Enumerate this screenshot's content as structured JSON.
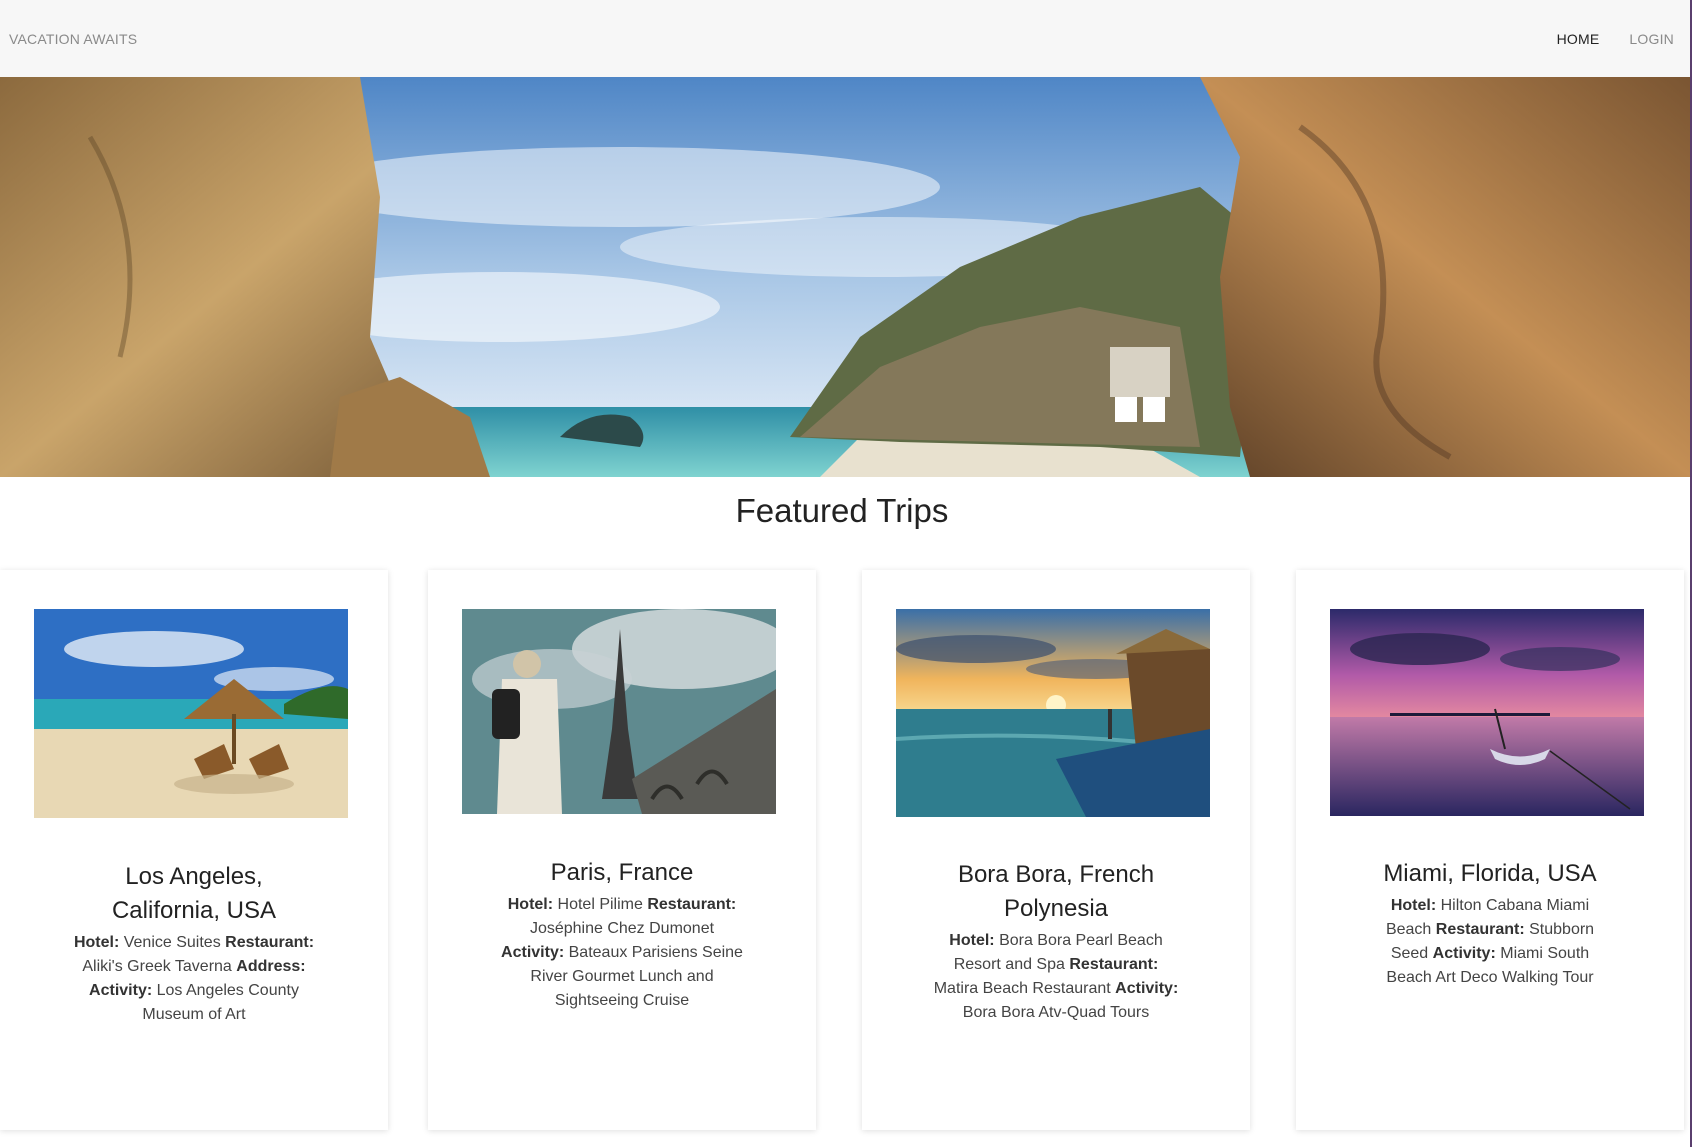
{
  "nav": {
    "brand": "VACATION AWAITS",
    "links": [
      {
        "label": "HOME",
        "active": true
      },
      {
        "label": "LOGIN",
        "active": false
      }
    ]
  },
  "hero": {
    "image": "coastal-cave-beach-photo"
  },
  "section": {
    "title": "Featured Trips"
  },
  "labels": {
    "hotel": "Hotel:",
    "restaurant": "Restaurant:",
    "address": "Address:",
    "activity": "Activity:"
  },
  "trips": [
    {
      "title": "Los Angeles, California, USA",
      "hotel": "Venice Suites",
      "restaurant": "Aliki's Greek Taverna",
      "address": "",
      "activity": "Los Angeles County Museum of Art",
      "image": "beach-umbrella-chairs-photo"
    },
    {
      "title": "Paris, France",
      "hotel": "Hotel Pilime",
      "restaurant": "Joséphine Chez Dumonet",
      "activity": "Bateaux Parisiens Seine River Gourmet Lunch and Sightseeing Cruise",
      "image": "eiffel-tower-tourist-photo"
    },
    {
      "title": "Bora Bora, French Polynesia",
      "hotel": "Bora Bora Pearl Beach Resort and Spa",
      "restaurant": "Matira Beach Restaurant",
      "activity": "Bora Bora Atv-Quad Tours",
      "image": "overwater-bungalow-sunset-photo"
    },
    {
      "title": "Miami, Florida, USA",
      "hotel": "Hilton Cabana Miami Beach",
      "restaurant": "Stubborn Seed",
      "activity": "Miami South Beach Art Deco Walking Tour",
      "image": "purple-sunset-boat-photo"
    }
  ]
}
